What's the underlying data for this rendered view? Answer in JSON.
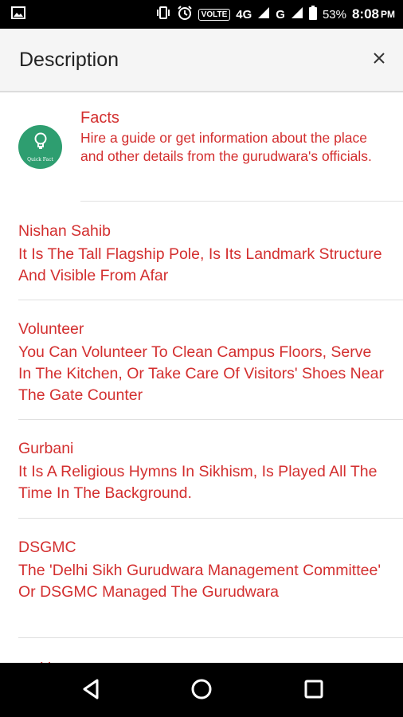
{
  "status_bar": {
    "network_type": "4G",
    "volte_label": "VOLTE",
    "carrier2": "G",
    "battery": "53%",
    "time": "8:08",
    "ampm": "PM"
  },
  "header": {
    "title": "Description"
  },
  "facts": {
    "icon_caption": "Quick Fact",
    "title": "Facts",
    "body": "Hire a guide or get information about the place and other details from the gurudwara's officials."
  },
  "items": [
    {
      "title": "Nishan Sahib",
      "body": "It Is The Tall Flagship Pole, Is Its Landmark Structure And Visible From Afar"
    },
    {
      "title": "Volunteer",
      "body": "You Can Volunteer To Clean Campus Floors, Serve In The Kitchen, Or Take Care Of Visitors' Shoes Near The Gate Counter"
    },
    {
      "title": "Gurbani",
      "body": "It Is A Religious Hymns In Sikhism, Is Played All The Time In The Background."
    },
    {
      "title": "DSGMC",
      "body": "The 'Delhi Sikh Gurudwara Management Committee' Or DSGMC Managed The Gurudwara"
    }
  ],
  "peek_item_title": "multi-storey",
  "colors": {
    "accent": "#d32f2f",
    "badge": "#2e9e70",
    "header_bg": "#f5f5f5"
  },
  "icons": [
    "image-icon",
    "vibrate-icon",
    "alarm-icon",
    "signal-icon",
    "battery-icon",
    "close-icon",
    "lightbulb-icon",
    "back-icon",
    "home-icon",
    "recents-icon"
  ]
}
